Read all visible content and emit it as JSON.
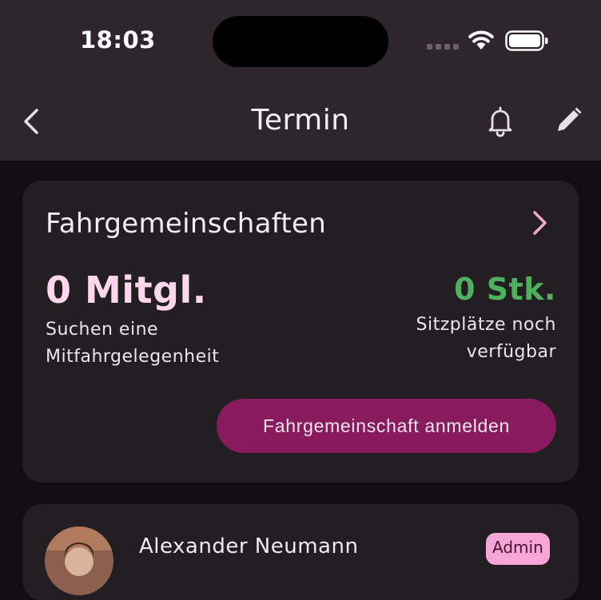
{
  "status_bar": {
    "time": "18:03"
  },
  "app_bar": {
    "title": "Termin",
    "icons": {
      "back": "chevron-left-icon",
      "notifications": "bell-icon",
      "edit": "pencil-icon"
    }
  },
  "carpool": {
    "title": "Fahrgemeinschaften",
    "members_count": "0 Mitgl.",
    "members_desc_line1": "Suchen eine",
    "members_desc_line2": "Mitfahrgelegenheit",
    "seats_count": "0 Stk.",
    "seats_desc_line1": "Sitzplätze noch",
    "seats_desc_line2": "verfügbar",
    "register_label": "Fahrgemeinschaft anmelden"
  },
  "member": {
    "name": "Alexander Neumann",
    "role_badge": "Admin"
  },
  "colors": {
    "app_bar_bg": "#2f252c",
    "page_bg": "#120d10",
    "card_bg": "#231e22",
    "accent_pink": "#ffd7ec",
    "chevron_pink": "#f3a9d3",
    "available_green": "#4fb05e",
    "button_bg": "#8a1a5e",
    "badge_bg": "#f6a6d6"
  }
}
